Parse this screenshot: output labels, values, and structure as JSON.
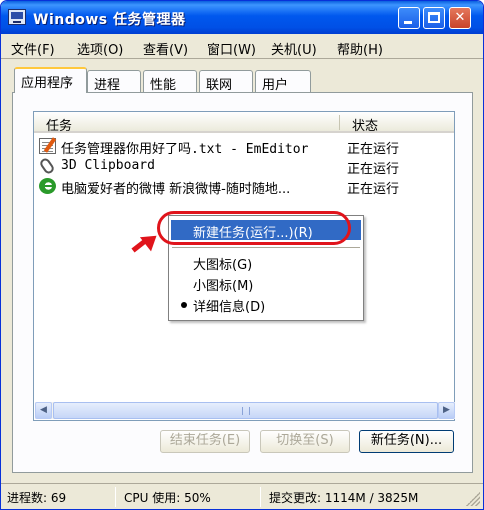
{
  "window": {
    "title": "Windows 任务管理器",
    "min_label": "",
    "close_label": "✕"
  },
  "menubar": {
    "items": [
      "文件(F)",
      "选项(O)",
      "查看(V)",
      "窗口(W)",
      "关机(U)",
      "帮助(H)"
    ]
  },
  "tabs": [
    {
      "label": "应用程序",
      "active": true
    },
    {
      "label": "进程",
      "active": false
    },
    {
      "label": "性能",
      "active": false
    },
    {
      "label": "联网",
      "active": false
    },
    {
      "label": "用户",
      "active": false
    }
  ],
  "list": {
    "col_task": "任务",
    "col_status": "状态",
    "rows": [
      {
        "task": "任务管理器你用好了吗.txt - EmEditor",
        "status": "正在运行",
        "icon": "notepad-icon"
      },
      {
        "task": "3D Clipboard",
        "status": "正在运行",
        "icon": "paperclip-icon"
      },
      {
        "task": "电脑爱好者的微博 新浪微博-随时随地...",
        "status": "正在运行",
        "icon": "ie-icon"
      }
    ]
  },
  "context_menu": {
    "items": [
      "新建任务(运行...)(R)",
      "大图标(G)",
      "小图标(M)",
      "详细信息(D)"
    ],
    "checked": "详细信息(D)"
  },
  "buttons": {
    "end_task": "结束任务(E)",
    "switch_to": "切换至(S)",
    "new_task": "新任务(N)..."
  },
  "statusbar": {
    "processes": "进程数: 69",
    "cpu": "CPU 使用: 50%",
    "commit": "提交更改: 1114M / 3825M"
  },
  "colors": {
    "titlebar": "#0058ee",
    "selection": "#316ac5",
    "annotation": "#e0141b"
  }
}
